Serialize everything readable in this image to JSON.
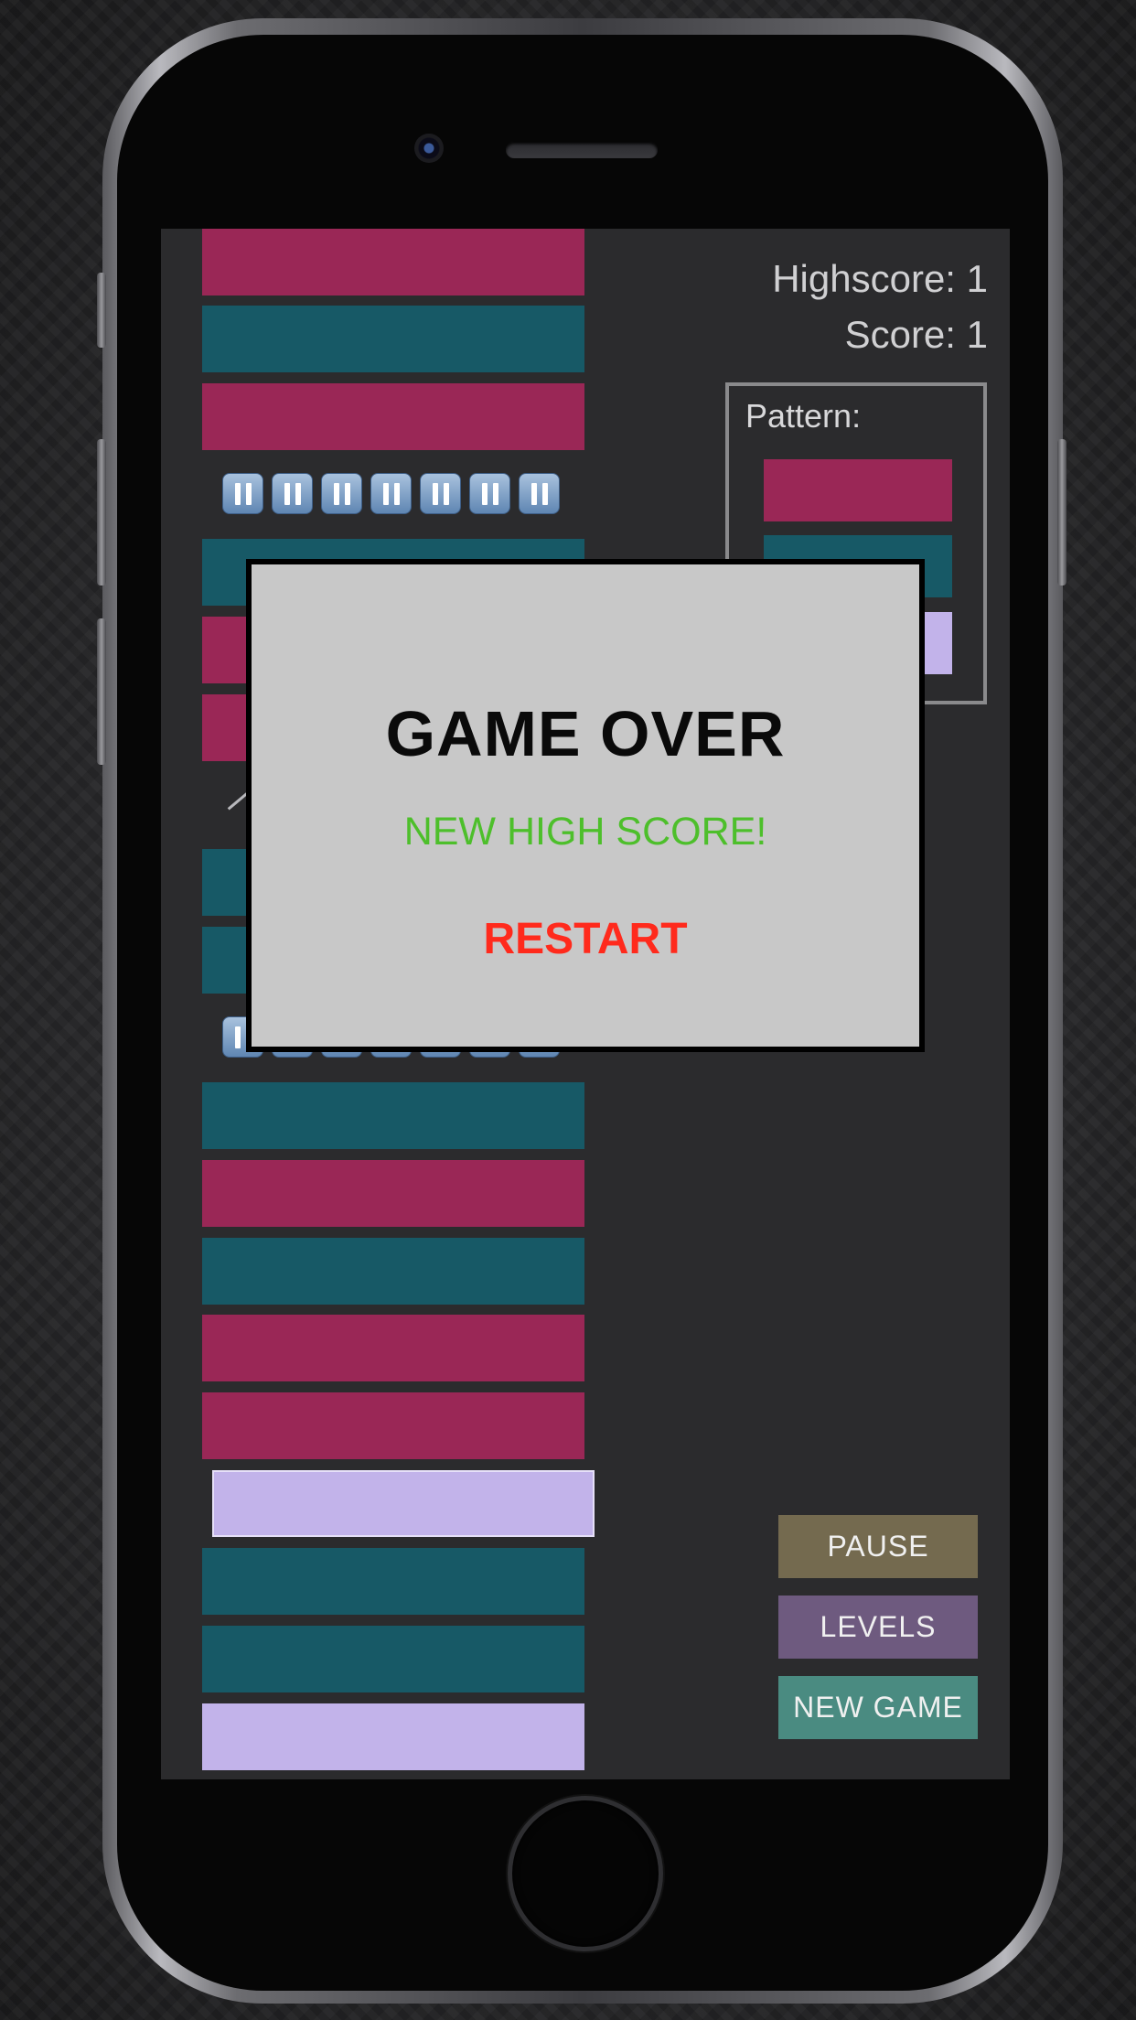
{
  "colors": {
    "magenta": "#9a2756",
    "teal": "#175966",
    "lavender": "#c2b3ea",
    "pause_btn": "#746a4f",
    "levels_btn": "#6e5a7f",
    "new_game_btn": "#4a8b81"
  },
  "hud": {
    "highscore": "Highscore: 1",
    "score": "Score: 1"
  },
  "pattern": {
    "label": "Pattern:",
    "bars": [
      "magenta",
      "teal",
      "lavender"
    ]
  },
  "stack": {
    "bars": [
      "magenta",
      "teal",
      "magenta",
      "pause-row",
      "teal",
      "magenta",
      "magenta",
      "blank",
      "teal",
      "teal",
      "pause-row",
      "teal",
      "magenta",
      "teal",
      "magenta",
      "magenta",
      "lavender",
      "teal",
      "teal",
      "lavender"
    ]
  },
  "controls": {
    "pause": "PAUSE",
    "levels": "LEVELS",
    "new_game": "NEW GAME"
  },
  "modal": {
    "title": "GAME OVER",
    "subtitle": "NEW HIGH SCORE!",
    "restart": "RESTART"
  }
}
